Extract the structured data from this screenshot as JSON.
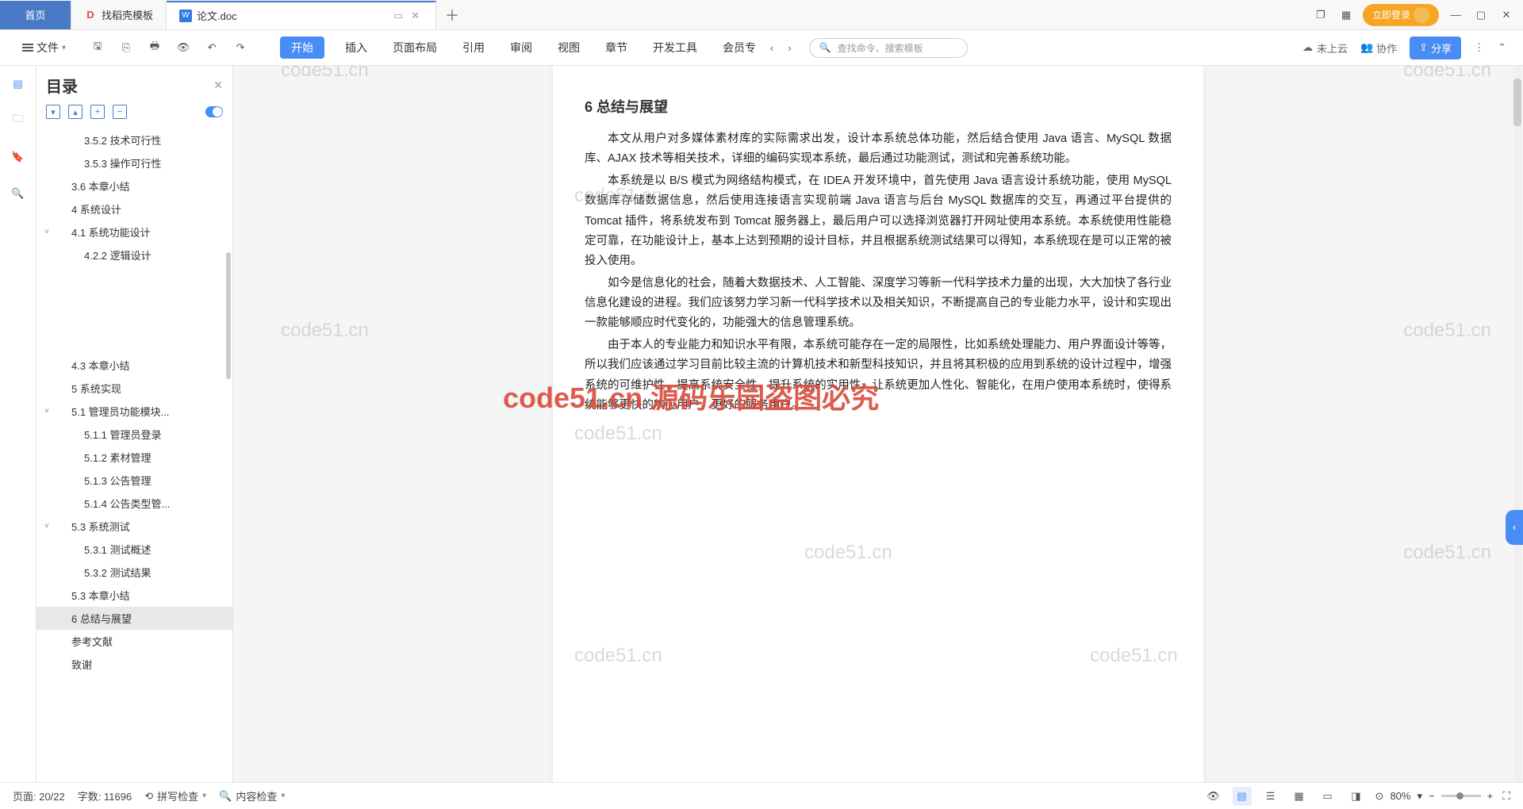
{
  "titleBar": {
    "homeTab": "首页",
    "templateTab": "找稻壳模板",
    "docTab": "论文.doc",
    "loginBtn": "立即登录"
  },
  "toolbar": {
    "fileMenu": "文件",
    "menus": {
      "start": "开始",
      "insert": "插入",
      "layout": "页面布局",
      "refs": "引用",
      "review": "审阅",
      "view": "视图",
      "chapter": "章节",
      "devtools": "开发工具",
      "member": "会员专"
    },
    "searchPlaceholder": "查找命令、搜索模板",
    "cloudStatus": "未上云",
    "collab": "协作",
    "share": "分享"
  },
  "outline": {
    "title": "目录",
    "items": [
      {
        "label": "3.5.2 技术可行性",
        "lvl": "l3"
      },
      {
        "label": "3.5.3 操作可行性",
        "lvl": "l3"
      },
      {
        "label": "3.6 本章小结",
        "lvl": "l2"
      },
      {
        "label": "4 系统设计",
        "lvl": "l2"
      },
      {
        "label": "4.1 系统功能设计",
        "lvl": "l2",
        "exp": true
      },
      {
        "label": "4.2.2 逻辑设计",
        "lvl": "l3"
      },
      {
        "label": "4.3 本章小结",
        "lvl": "l2",
        "gap": true
      },
      {
        "label": "5 系统实现",
        "lvl": "l2"
      },
      {
        "label": "5.1 管理员功能模块...",
        "lvl": "l2",
        "exp": true
      },
      {
        "label": "5.1.1 管理员登录",
        "lvl": "l3"
      },
      {
        "label": "5.1.2 素材管理",
        "lvl": "l3"
      },
      {
        "label": "5.1.3 公告管理",
        "lvl": "l3"
      },
      {
        "label": "5.1.4 公告类型管...",
        "lvl": "l3"
      },
      {
        "label": "5.3 系统测试",
        "lvl": "l2",
        "exp": true
      },
      {
        "label": "5.3.1 测试概述",
        "lvl": "l3"
      },
      {
        "label": "5.3.2 测试结果",
        "lvl": "l3"
      },
      {
        "label": "5.3 本章小结",
        "lvl": "l2"
      },
      {
        "label": "6 总结与展望",
        "lvl": "l2",
        "active": true
      },
      {
        "label": "参考文献",
        "lvl": "l2"
      },
      {
        "label": "致谢",
        "lvl": "l2"
      }
    ]
  },
  "document": {
    "heading": "6 总结与展望",
    "p1": "本文从用户对多媒体素材库的实际需求出发，设计本系统总体功能，然后结合使用 Java 语言、MySQL 数据库、AJAX 技术等相关技术，详细的编码实现本系统，最后通过功能测试，测试和完善系统功能。",
    "p2": "本系统是以 B/S 模式为网络结构模式，在 IDEA 开发环境中，首先使用 Java 语言设计系统功能，使用 MySQL 数据库存储数据信息，然后使用连接语言实现前端 Java 语言与后台 MySQL 数据库的交互，再通过平台提供的 Tomcat 插件，将系统发布到 Tomcat 服务器上，最后用户可以选择浏览器打开网址使用本系统。本系统使用性能稳定可靠，在功能设计上，基本上达到预期的设计目标，并且根据系统测试结果可以得知，本系统现在是可以正常的被投入使用。",
    "p3": "如今是信息化的社会，随着大数据技术、人工智能、深度学习等新一代科学技术力量的出现，大大加快了各行业信息化建设的进程。我们应该努力学习新一代科学技术以及相关知识，不断提高自己的专业能力水平，设计和实现出一款能够顺应时代变化的，功能强大的信息管理系统。",
    "p4": "由于本人的专业能力和知识水平有限，本系统可能存在一定的局限性，比如系统处理能力、用户界面设计等等，所以我们应该通过学习目前比较主流的计算机技术和新型科技知识，并且将其积极的应用到系统的设计过程中，增强系统的可维护性，提高系统安全性，提升系统的实用性，让系统更加人性化、智能化，在用户使用本系统时，使得系统能够更快的响应用户，更好的服务用户。",
    "watermarks": {
      "wm1": "code51.cn",
      "wmRed": "code51.cn 源码乐园盗图必究"
    }
  },
  "statusBar": {
    "page": "页面: 20/22",
    "wordCount": "字数: 11696",
    "spellCheck": "拼写检查",
    "contentCheck": "内容检查",
    "zoom": "80%"
  }
}
